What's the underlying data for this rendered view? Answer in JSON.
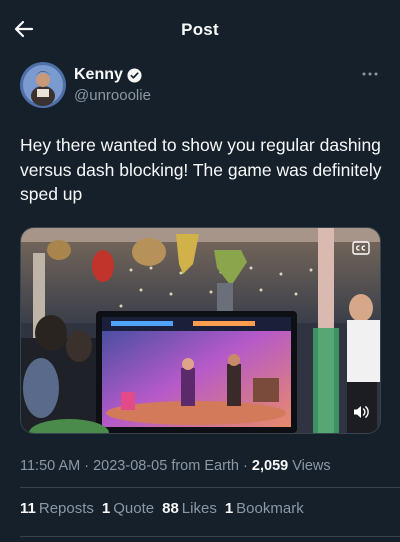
{
  "header": {
    "title": "Post",
    "back_icon": "arrow-left-icon"
  },
  "author": {
    "name": "Kenny",
    "handle": "@unrooolie",
    "verified_icon": "verified-badge-icon",
    "more_icon": "more-dots-icon"
  },
  "tweet": {
    "text": "Hey there wanted to show you regular dashing versus dash blocking! The game was definitely sped up"
  },
  "media": {
    "type": "video",
    "captions_icon": "closed-captions-icon",
    "volume_icon": "volume-icon"
  },
  "meta": {
    "time": "11:50 AM",
    "sep1": "·",
    "date": "2023-08-05",
    "source": "from Earth",
    "sep2": "·",
    "views_count": "2,059",
    "views_label": "Views"
  },
  "stats": {
    "reposts_count": "11",
    "reposts_label": "Reposts",
    "quotes_count": "1",
    "quotes_label": "Quote",
    "likes_count": "88",
    "likes_label": "Likes",
    "bookmarks_count": "1",
    "bookmarks_label": "Bookmark"
  },
  "colors": {
    "background": "#15202b",
    "text": "#f7f9f9",
    "secondary": "#8b98a5",
    "border": "#38444d",
    "verified": "#ffffff"
  }
}
